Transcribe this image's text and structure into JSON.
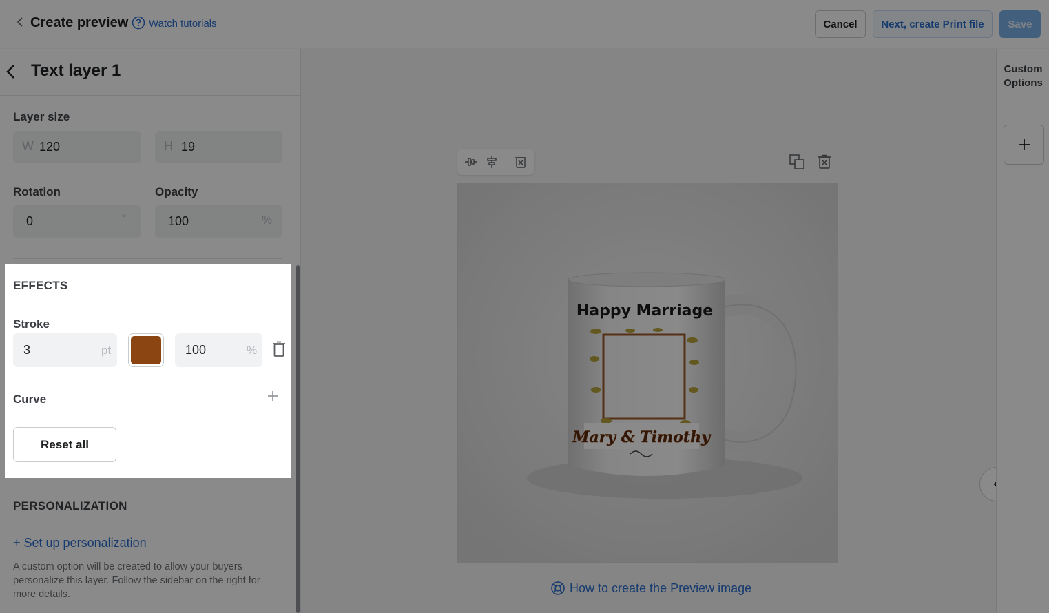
{
  "header": {
    "title": "Create preview",
    "tutorials_link": "Watch tutorials",
    "cancel_label": "Cancel",
    "next_label": "Next, create Print file",
    "save_label": "Save"
  },
  "panel": {
    "title": "Text layer 1",
    "layer_size": {
      "label": "Layer size",
      "width_prefix": "W",
      "width_value": "120",
      "height_prefix": "H",
      "height_value": "19"
    },
    "rotation": {
      "label": "Rotation",
      "value": "0",
      "unit": "°"
    },
    "opacity": {
      "label": "Opacity",
      "value": "100",
      "unit": "%"
    },
    "effects": {
      "title": "EFFECTS",
      "stroke_label": "Stroke",
      "stroke_width": "3",
      "stroke_width_unit": "pt",
      "stroke_color": "#8B4513",
      "stroke_opacity": "100",
      "stroke_opacity_unit": "%",
      "curve_label": "Curve",
      "reset_label": "Reset all"
    },
    "personalization": {
      "title": "PERSONALIZATION",
      "setup_link": "+ Set up personalization",
      "help_text": "A custom option will be created to allow your buyers personalize this layer. Follow the sidebar on the right for more details."
    }
  },
  "canvas": {
    "mug_heading": "Happy Marriage",
    "mug_names": "Mary & Timothy",
    "how_to_link": "How to create the Preview image"
  },
  "right_rail": {
    "custom_options_label": "Custom\nOptions"
  },
  "colors": {
    "accent_blue": "#2c6ecb",
    "save_disabled": "#7bb0e8",
    "stroke_brown": "#8B4513"
  }
}
